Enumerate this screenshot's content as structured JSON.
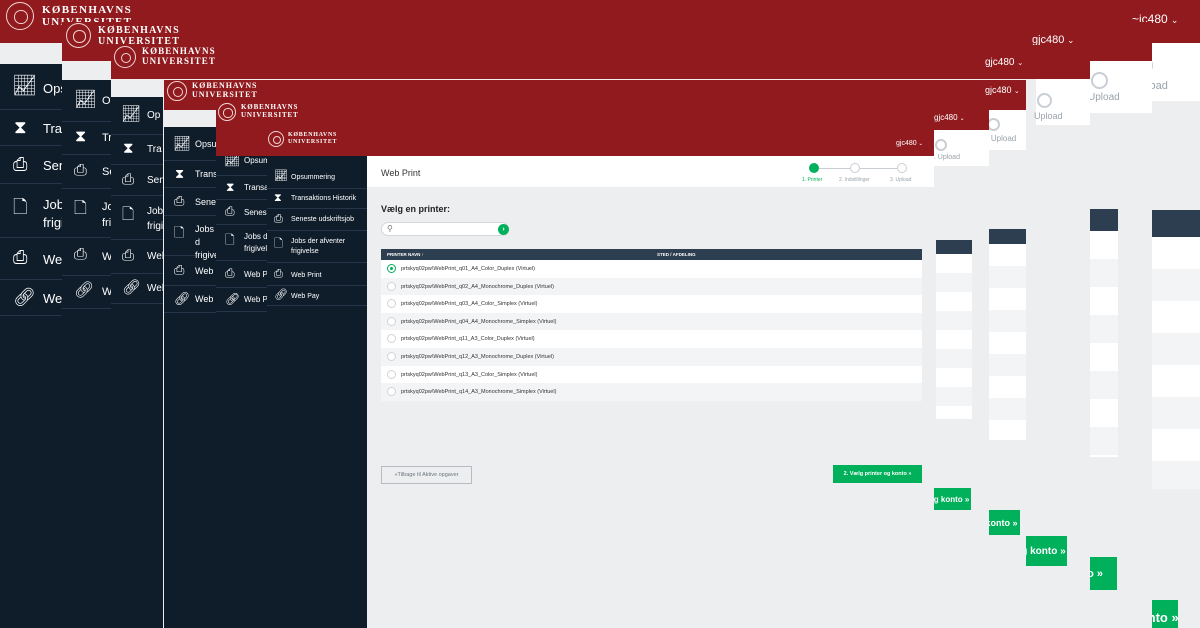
{
  "brand": {
    "line1": "KØBENHAVNS",
    "line2": "UNIVERSITET",
    "primary_color": "#901a1e",
    "sidebar_color": "#0f1d2b",
    "accent_color": "#00b05a"
  },
  "user": {
    "name": "gjc480",
    "name_top_partial": "~jc480"
  },
  "nav": {
    "items": [
      {
        "label": "Opsummering",
        "icon": "chart-line-icon"
      },
      {
        "label": "Transaktions Historik",
        "icon": "hourglass-icon"
      },
      {
        "label": "Seneste udskriftsjob",
        "icon": "printer-icon"
      },
      {
        "label": "Jobs der afventer frigivelse",
        "icon": "pending-document-icon"
      },
      {
        "label": "Web Print",
        "icon": "web-print-icon"
      },
      {
        "label": "Web Pay",
        "icon": "link-icon"
      }
    ],
    "layer_labels": [
      [
        "Ops",
        "Tra",
        "Sen",
        "Job frigi",
        "Web",
        "Web"
      ],
      [
        "Op",
        "Tra",
        "Sen",
        "Job frigi",
        "Web",
        "Web"
      ],
      [
        "Op",
        "Tra",
        "Sen",
        "Job frigi",
        "Web",
        "Web"
      ],
      [
        "Opsu",
        "Trans",
        "Senes",
        "Jobs d frigive",
        "Web P",
        "Web P"
      ],
      [
        "Opsum",
        "Transa",
        "Senest",
        "Jobs d frigivel",
        "Web P",
        "Web P"
      ]
    ]
  },
  "page": {
    "title": "Web Print",
    "section_title": "Vælg en printer:",
    "search_placeholder": "",
    "search_go_label": "›"
  },
  "steps": [
    {
      "label": "1. Printer",
      "active": true
    },
    {
      "label": "2. Indstillinger",
      "active": false
    },
    {
      "label": "3. Upload",
      "active": false
    }
  ],
  "step_upload_partial": "3. Upload",
  "step_upload_tiny": "3. Upload",
  "ghost_upload": "Upload",
  "table": {
    "col_name": "PRINTER NAVN ↑",
    "col_location": "STED / AFDELING",
    "rows": [
      {
        "name": "prtskyq02pw\\WebPrint_q01_A4_Color_Duplex (Virtuel)",
        "selected": true
      },
      {
        "name": "prtskyq02pw\\WebPrint_q02_A4_Monochrome_Duplex (Virtuel)",
        "selected": false
      },
      {
        "name": "prtskyq02pw\\WebPrint_q03_A4_Color_Simplex (Virtuel)",
        "selected": false
      },
      {
        "name": "prtskyq02pw\\WebPrint_q04_A4_Monochrome_Simplex (Virtuel)",
        "selected": false
      },
      {
        "name": "prtskyq02pw\\WebPrint_q11_A3_Color_Duplex (Virtuel)",
        "selected": false
      },
      {
        "name": "prtskyq02pw\\WebPrint_q12_A3_Monochrome_Duplex (Virtuel)",
        "selected": false
      },
      {
        "name": "prtskyq02pw\\WebPrint_q13_A3_Color_Simplex (Virtuel)",
        "selected": false
      },
      {
        "name": "prtskyq02pw\\WebPrint_q14_A3_Monochrome_Simplex (Virtuel)",
        "selected": false
      }
    ]
  },
  "buttons": {
    "back": "«Tilbage til Aktive opgaver",
    "next": "2. Vælg printer og konto »",
    "next_partial": "2. Vælg printer og konto »",
    "next_partial2": "2. Vælg printer og konto »",
    "next_partial3": "2. Vælg printer og konto »",
    "next_partial4": "konto »"
  }
}
